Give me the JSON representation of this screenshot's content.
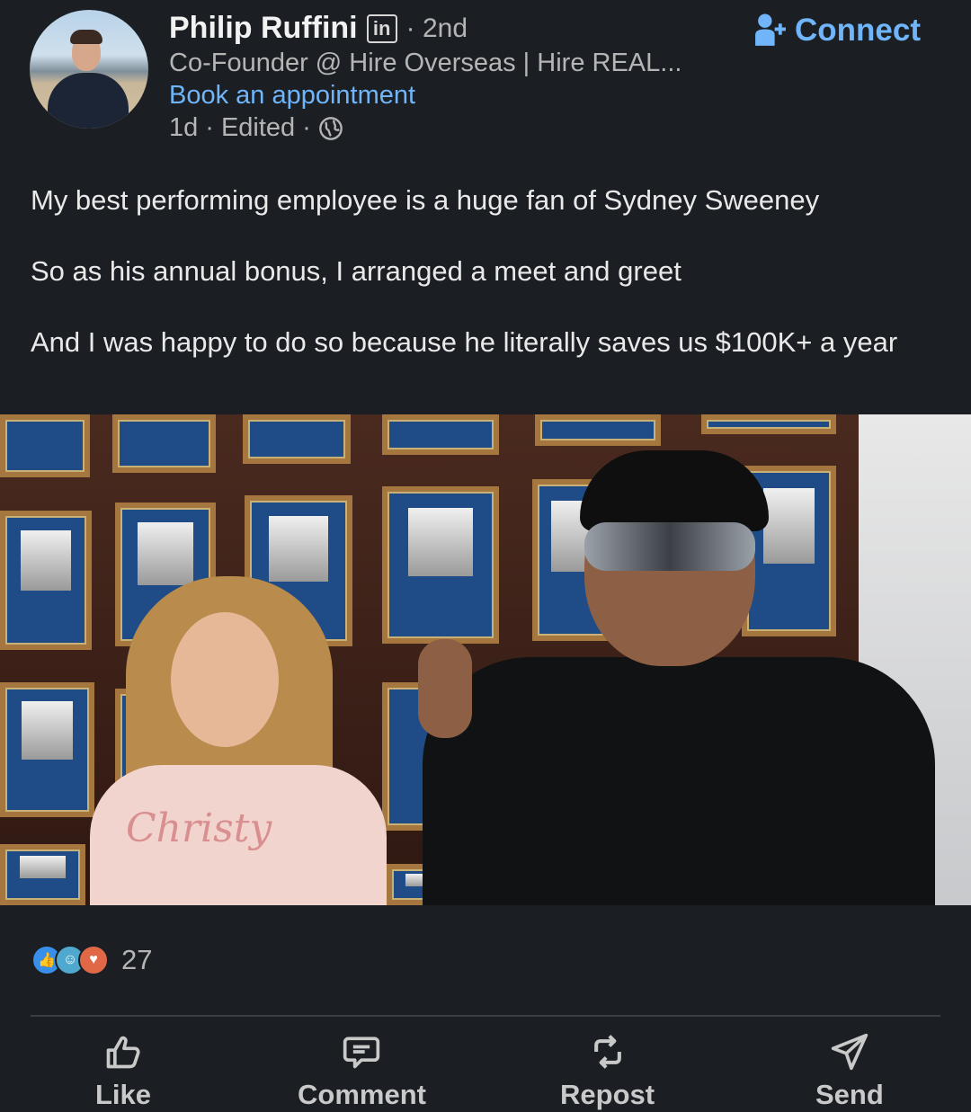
{
  "post": {
    "author": {
      "name": "Philip Ruffini",
      "badge": "in",
      "degree": "2nd",
      "headline": "Co-Founder @ Hire Overseas | Hire REAL...",
      "appointment_label": "Book an appointment",
      "time": "1d",
      "edited": "Edited",
      "visibility_icon": "globe-icon"
    },
    "connect_label": "Connect",
    "paragraphs": [
      "My best performing employee is a huge fan of Sydney Sweeney",
      "So as his annual bonus, I arranged a meet and greet",
      "And I was happy to do so because he literally saves us $100K+ a year"
    ],
    "photo": {
      "shirt_text": "Christy"
    },
    "reactions": {
      "icons": [
        "like-reaction-icon",
        "funny-reaction-icon",
        "love-reaction-icon"
      ],
      "count": "27"
    },
    "actions": {
      "like": "Like",
      "comment": "Comment",
      "repost": "Repost",
      "send": "Send"
    }
  },
  "colors": {
    "background": "#1b1f23",
    "link": "#70b5f9",
    "text_primary": "#e9e9e9",
    "text_secondary": "#b5b5b5"
  }
}
